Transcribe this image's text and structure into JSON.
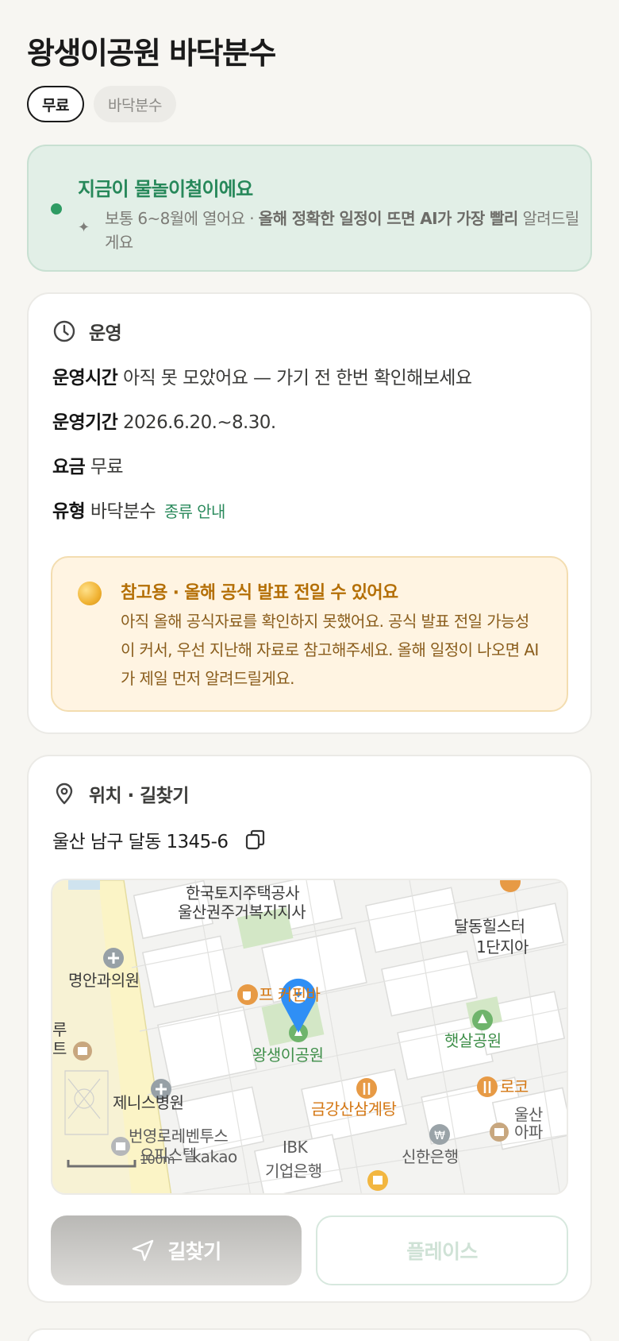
{
  "page": {
    "title": "왕생이공원 바닥분수",
    "chips": [
      "무료",
      "바닥분수"
    ]
  },
  "season": {
    "headline": "지금이 물놀이철이에요",
    "note_plain": "보통 6~8월에 열어요 · ",
    "note_bold": "올해 정확한 일정이 뜨면 AI가 가장 빨리",
    "note_tail": "알려드릴게요",
    "status_color": "#2e9b63"
  },
  "operation": {
    "section_title": "운영",
    "section_icon": "clock-icon",
    "rows": [
      {
        "key": "운영시간",
        "value": "아직 못 모았어요 — 가기 전 한번 확인해보세요"
      },
      {
        "key": "운영기간",
        "value": "2026.6.20.~8.30."
      },
      {
        "key": "요금",
        "value": "무료"
      },
      {
        "key": "유형",
        "value": "바닥분수",
        "link": "종류 안내"
      }
    ],
    "notice": {
      "icon": "coin-icon",
      "title": "참고용 · 올해 공식 발표 전일 수 있어요",
      "body": "아직 올해 공식자료를 확인하지 못했어요. 공식 발표 전일 가능성이 커서, 우선 지난해 자료로 참고해주세요. 올해 일정이 나오면 AI가 제일 먼저 알려드릴게요."
    }
  },
  "location": {
    "section_title": "위치 · 길찾기",
    "section_icon": "location-pin-icon",
    "address": "울산 남구 달동 1345-6",
    "copy_icon": "copy-icon",
    "map": {
      "labels": {
        "lh_line1": "한국토지주택공사",
        "lh_line2": "울산권주거복지지사",
        "dalhill_line1": "달동힐스터",
        "dalhill_line2": "1단지아",
        "clinic": "명안과의원",
        "cafe": "프   커핀바",
        "park": "왕생이공원",
        "sunpark": "햇살공원",
        "left_edge": "루\n트",
        "hospital": "제니스병원",
        "restaurant": "금강산삼계탕",
        "roco": "로코",
        "ulsan": "울산\n아파",
        "building_line1": "번영로레벤투스",
        "building_line2": "오피스텔",
        "ibk_line1": "IBK",
        "ibk_line2": "기업은행",
        "shinhan": "신한은행",
        "scale": "100m",
        "brand": "kakao"
      }
    },
    "buttons": {
      "directions": "길찾기",
      "place": "플레이스"
    }
  }
}
